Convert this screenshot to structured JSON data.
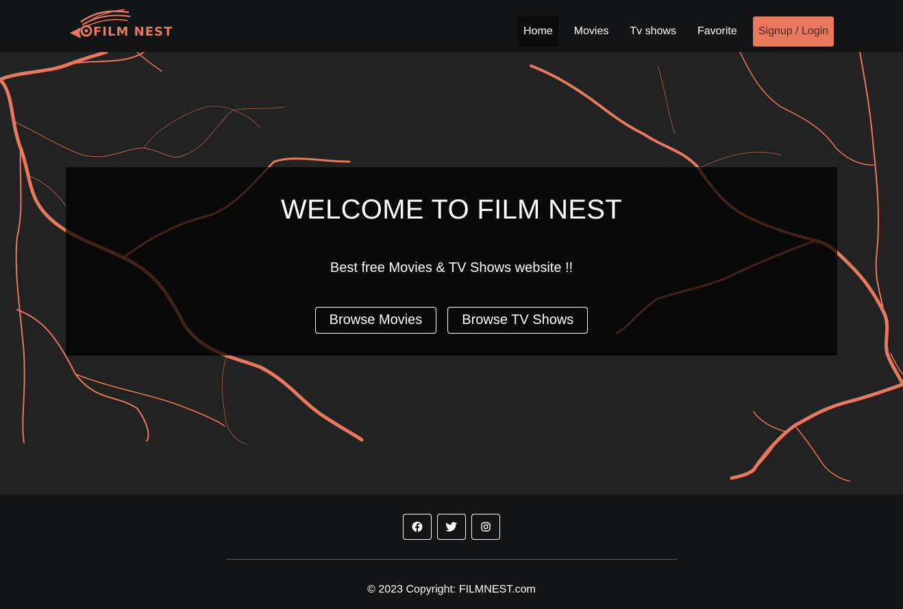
{
  "brand": {
    "name": "FILM NEST",
    "accent_color": "#e8795c"
  },
  "nav": {
    "items": [
      {
        "label": "Home",
        "active": true
      },
      {
        "label": "Movies",
        "active": false
      },
      {
        "label": "Tv shows",
        "active": false
      },
      {
        "label": "Favorite",
        "active": false
      }
    ],
    "signup_label": "Signup / Login"
  },
  "hero": {
    "title": "WELCOME TO FILM NEST",
    "subtitle": "Best free Movies & TV Shows website !!",
    "browse_movies_label": "Browse Movies",
    "browse_tv_label": "Browse TV Shows"
  },
  "footer": {
    "social": [
      {
        "icon": "facebook-icon"
      },
      {
        "icon": "twitter-icon"
      },
      {
        "icon": "instagram-icon"
      }
    ],
    "copyright": "© 2023 Copyright: FILMNEST.com"
  }
}
